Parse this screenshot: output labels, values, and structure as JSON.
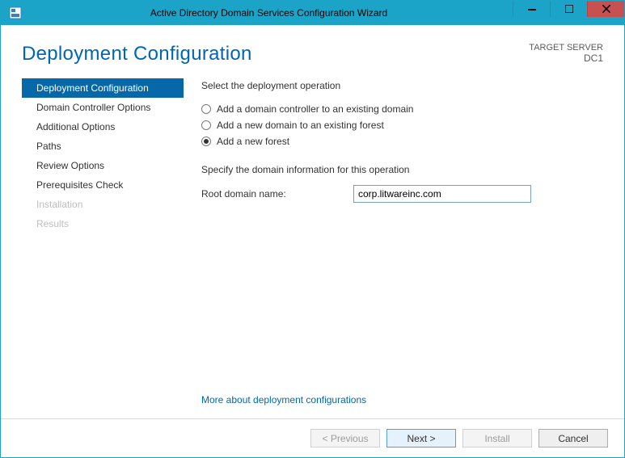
{
  "window": {
    "title": "Active Directory Domain Services Configuration Wizard"
  },
  "header": {
    "page_title": "Deployment Configuration",
    "target_server_label": "TARGET SERVER",
    "target_server": "DC1"
  },
  "nav": [
    {
      "label": "Deployment Configuration",
      "active": true,
      "disabled": false
    },
    {
      "label": "Domain Controller Options",
      "active": false,
      "disabled": false
    },
    {
      "label": "Additional Options",
      "active": false,
      "disabled": false
    },
    {
      "label": "Paths",
      "active": false,
      "disabled": false
    },
    {
      "label": "Review Options",
      "active": false,
      "disabled": false
    },
    {
      "label": "Prerequisites Check",
      "active": false,
      "disabled": false
    },
    {
      "label": "Installation",
      "active": false,
      "disabled": true
    },
    {
      "label": "Results",
      "active": false,
      "disabled": true
    }
  ],
  "main": {
    "select_op_label": "Select the deployment operation",
    "radios": [
      {
        "label": "Add a domain controller to an existing domain",
        "selected": false
      },
      {
        "label": "Add a new domain to an existing forest",
        "selected": false
      },
      {
        "label": "Add a new forest",
        "selected": true
      }
    ],
    "specify_label": "Specify the domain information for this operation",
    "root_domain_label": "Root domain name:",
    "root_domain_value": "corp.litwareinc.com",
    "more_link": "More about deployment configurations"
  },
  "buttons": {
    "previous": "< Previous",
    "next": "Next >",
    "install": "Install",
    "cancel": "Cancel"
  }
}
